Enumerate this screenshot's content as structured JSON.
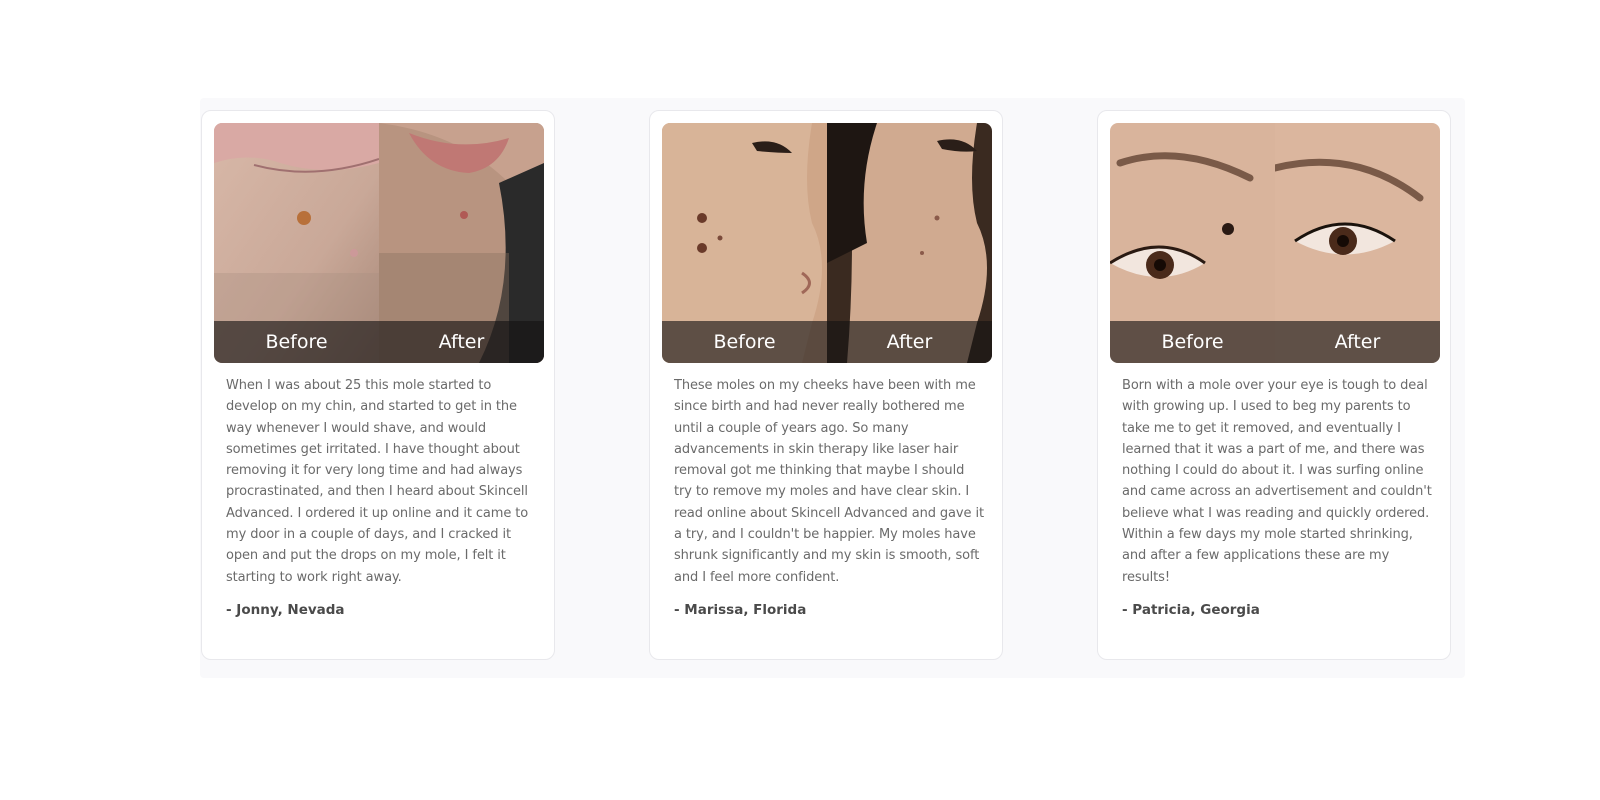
{
  "testimonials": [
    {
      "before_label": "Before",
      "after_label": "After",
      "text": "When I was about 25 this mole started to develop on my chin, and started to get in the way whenever I would shave, and would sometimes get irritated. I have thought about removing it for very long time and had always procrastinated, and then I heard about Skincell Advanced. I ordered it up online and it came to my door in a couple of days, and I cracked it open and put the drops on my mole, I felt it starting to work right away.",
      "author": "- Jonny, Nevada"
    },
    {
      "before_label": "Before",
      "after_label": "After",
      "text": "These moles on my cheeks have been with me since birth and had never really bothered me until a couple of years ago. So many advancements in skin therapy like laser hair removal got me thinking that maybe I should try to remove my moles and have clear skin. I read online about Skincell Advanced and gave it a try, and I couldn't be happier. My moles have shrunk significantly and my skin is smooth, soft and I feel more confident.",
      "author": "- Marissa, Florida"
    },
    {
      "before_label": "Before",
      "after_label": "After",
      "text": "Born with a mole over your eye is tough to deal with growing up. I used to beg my parents to take me to get it removed, and eventually I learned that it was a part of me, and there was nothing I could do about it. I was surfing online and came across an advertisement and couldn't believe what I was reading and quickly ordered. Within a few days my mole started shrinking, and after a few applications these are my results!",
      "author": "- Patricia, Georgia"
    }
  ]
}
